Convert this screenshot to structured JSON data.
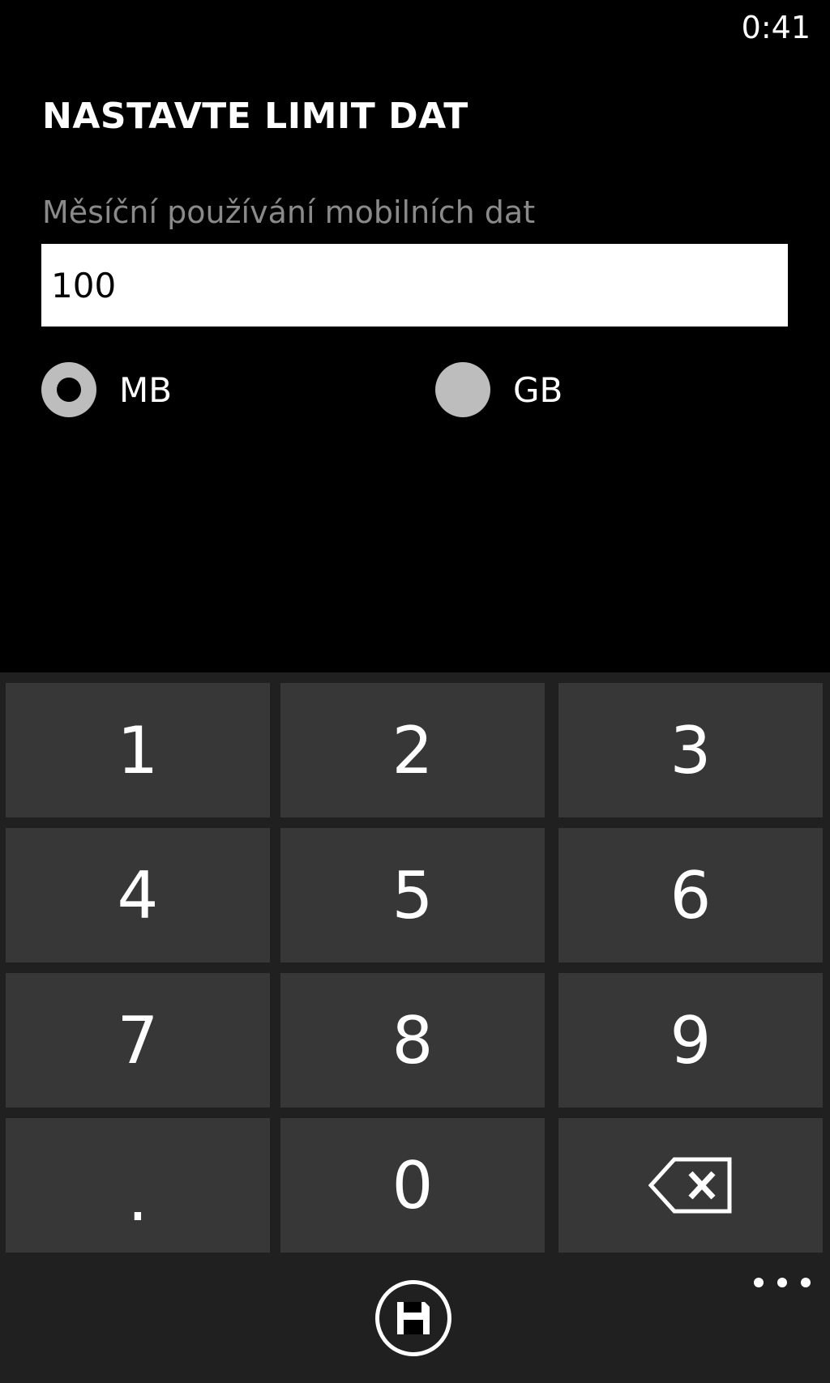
{
  "status_bar": {
    "time": "0:41"
  },
  "page": {
    "title": "NASTAVTE LIMIT DAT"
  },
  "limit_field": {
    "label": "Měsíční používání mobilních dat",
    "value": "100"
  },
  "units": {
    "options": [
      {
        "label": "MB",
        "selected": true
      },
      {
        "label": "GB",
        "selected": false
      }
    ]
  },
  "keypad": {
    "keys": [
      "1",
      "2",
      "3",
      "4",
      "5",
      "6",
      "7",
      "8",
      "9",
      ".",
      "0"
    ],
    "backspace_icon": "backspace-icon"
  },
  "app_bar": {
    "save_icon": "save-icon",
    "more_icon": "more-icon"
  },
  "colors": {
    "background": "#000000",
    "keypad_background": "#1f201f",
    "key_background": "#373737",
    "label_gray": "#8a8a8a",
    "radio_gray": "#bdbdbd"
  }
}
